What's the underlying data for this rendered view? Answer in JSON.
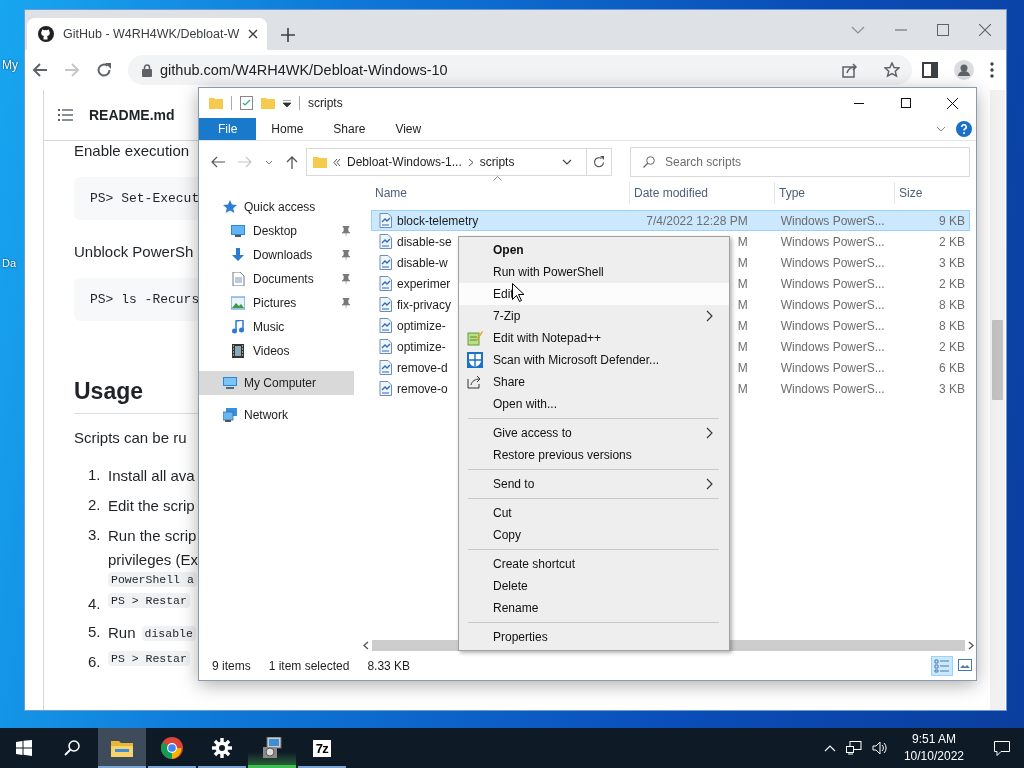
{
  "desktop": {
    "icon_labels": [
      "My",
      "Da"
    ]
  },
  "browser": {
    "tab": {
      "title": "GitHub - W4RH4WK/Debloat-W",
      "selected": true
    },
    "url": "github.com/W4RH4WK/Debloat-Windows-10",
    "readme": {
      "file": "README.md",
      "blocks": [
        {
          "kind": "paragraph",
          "text": "Enable execution"
        },
        {
          "kind": "code",
          "text": "PS> Set-Execut"
        },
        {
          "kind": "paragraph",
          "text": "Unblock PowerSh"
        },
        {
          "kind": "code",
          "text": "PS> ls -Recurs"
        },
        {
          "kind": "heading",
          "text": "Usage"
        },
        {
          "kind": "paragraph",
          "text": "Scripts can be ru"
        },
        {
          "kind": "list",
          "items": [
            {
              "number": "1.",
              "lines": [
                [
                  {
                    "text": "Install all ava",
                    "code": false
                  }
                ]
              ]
            },
            {
              "number": "2.",
              "lines": [
                [
                  {
                    "text": "Edit the scrip",
                    "code": false
                  }
                ]
              ]
            },
            {
              "number": "3.",
              "lines": [
                [
                  {
                    "text": "Run the scrip",
                    "code": false
                  }
                ],
                [
                  {
                    "text": "privileges (Ex",
                    "code": false
                  }
                ],
                [
                  {
                    "text": "PowerShell a",
                    "code": true
                  }
                ]
              ]
            },
            {
              "number": "4.",
              "lines": [
                [
                  {
                    "text": "PS > Restar",
                    "code": true
                  }
                ]
              ]
            },
            {
              "number": "5.",
              "lines": [
                [
                  {
                    "text": "Run",
                    "code": false
                  },
                  {
                    "text": "disable",
                    "code": true
                  }
                ]
              ]
            },
            {
              "number": "6.",
              "lines": [
                [
                  {
                    "text": "PS > Restar",
                    "code": true
                  }
                ]
              ]
            }
          ]
        }
      ]
    }
  },
  "explorer": {
    "title": "scripts",
    "ribbon_tabs": [
      {
        "label": "File",
        "selected": true
      },
      {
        "label": "Home",
        "selected": false
      },
      {
        "label": "Share",
        "selected": false
      },
      {
        "label": "View",
        "selected": false
      }
    ],
    "address": {
      "parent": "Debloat-Windows-1...",
      "current": "scripts"
    },
    "search": {
      "placeholder": "Search scripts"
    },
    "nav": [
      {
        "label": "Quick access",
        "kind": "quick-access",
        "pinned": false,
        "selected": false
      },
      {
        "label": "Desktop",
        "kind": "desktop",
        "pinned": true,
        "selected": false
      },
      {
        "label": "Downloads",
        "kind": "downloads",
        "pinned": true,
        "selected": false
      },
      {
        "label": "Documents",
        "kind": "documents",
        "pinned": true,
        "selected": false
      },
      {
        "label": "Pictures",
        "kind": "pictures",
        "pinned": true,
        "selected": false
      },
      {
        "label": "Music",
        "kind": "music",
        "pinned": false,
        "selected": false
      },
      {
        "label": "Videos",
        "kind": "videos",
        "pinned": false,
        "selected": false
      },
      {
        "label": "My Computer",
        "kind": "computer",
        "pinned": false,
        "selected": true
      },
      {
        "label": "Network",
        "kind": "network",
        "pinned": false,
        "selected": false
      }
    ],
    "columns": [
      "Name",
      "Date modified",
      "Type",
      "Size"
    ],
    "files": [
      {
        "name": "block-telemetry",
        "date": "7/4/2022 12:28 PM",
        "type": "Windows PowerS...",
        "size": "9 KB",
        "selected": true
      },
      {
        "name": "disable-se",
        "date": "M",
        "type": "Windows PowerS...",
        "size": "2 KB",
        "selected": false
      },
      {
        "name": "disable-w",
        "date": "M",
        "type": "Windows PowerS...",
        "size": "3 KB",
        "selected": false
      },
      {
        "name": "experimer",
        "date": "M",
        "type": "Windows PowerS...",
        "size": "2 KB",
        "selected": false
      },
      {
        "name": "fix-privacy",
        "date": "M",
        "type": "Windows PowerS...",
        "size": "8 KB",
        "selected": false
      },
      {
        "name": "optimize-",
        "date": "M",
        "type": "Windows PowerS...",
        "size": "8 KB",
        "selected": false
      },
      {
        "name": "optimize-",
        "date": "M",
        "type": "Windows PowerS...",
        "size": "2 KB",
        "selected": false
      },
      {
        "name": "remove-d",
        "date": "M",
        "type": "Windows PowerS...",
        "size": "6 KB",
        "selected": false
      },
      {
        "name": "remove-o",
        "date": "M",
        "type": "Windows PowerS...",
        "size": "3 KB",
        "selected": false
      }
    ],
    "status": {
      "count": "9 items",
      "selection": "1 item selected",
      "size": "8.33 KB"
    }
  },
  "context_menu": {
    "items": [
      {
        "kind": "command",
        "label": "Open",
        "default": true,
        "highlighted": false,
        "submenu": false
      },
      {
        "kind": "command",
        "label": "Run with PowerShell",
        "default": false,
        "highlighted": false,
        "submenu": false
      },
      {
        "kind": "command",
        "label": "Edit",
        "default": false,
        "highlighted": true,
        "submenu": false
      },
      {
        "kind": "command",
        "label": "7-Zip",
        "default": false,
        "highlighted": false,
        "submenu": true
      },
      {
        "kind": "notepad",
        "label": "Edit with Notepad++",
        "default": false,
        "highlighted": false,
        "submenu": false
      },
      {
        "kind": "defender",
        "label": "Scan with Microsoft Defender...",
        "default": false,
        "highlighted": false,
        "submenu": false
      },
      {
        "kind": "share",
        "label": "Share",
        "default": false,
        "highlighted": false,
        "submenu": false
      },
      {
        "kind": "command",
        "label": "Open with...",
        "default": false,
        "highlighted": false,
        "submenu": false
      },
      {
        "kind": "separator"
      },
      {
        "kind": "command",
        "label": "Give access to",
        "default": false,
        "highlighted": false,
        "submenu": true
      },
      {
        "kind": "command",
        "label": "Restore previous versions",
        "default": false,
        "highlighted": false,
        "submenu": false
      },
      {
        "kind": "separator"
      },
      {
        "kind": "command",
        "label": "Send to",
        "default": false,
        "highlighted": false,
        "submenu": true
      },
      {
        "kind": "separator"
      },
      {
        "kind": "command",
        "label": "Cut",
        "default": false,
        "highlighted": false,
        "submenu": false
      },
      {
        "kind": "command",
        "label": "Copy",
        "default": false,
        "highlighted": false,
        "submenu": false
      },
      {
        "kind": "separator"
      },
      {
        "kind": "command",
        "label": "Create shortcut",
        "default": false,
        "highlighted": false,
        "submenu": false
      },
      {
        "kind": "command",
        "label": "Delete",
        "default": false,
        "highlighted": false,
        "submenu": false
      },
      {
        "kind": "command",
        "label": "Rename",
        "default": false,
        "highlighted": false,
        "submenu": false
      },
      {
        "kind": "separator"
      },
      {
        "kind": "command",
        "label": "Properties",
        "default": false,
        "highlighted": false,
        "submenu": false
      }
    ]
  },
  "taskbar": {
    "apps": [
      {
        "kind": "explorer",
        "active": true,
        "attention": false
      },
      {
        "kind": "chrome",
        "active": false,
        "attention": false
      },
      {
        "kind": "settings",
        "active": false,
        "attention": false
      },
      {
        "kind": "installer",
        "active": false,
        "attention": true
      },
      {
        "kind": "sevenzip",
        "label": "7z",
        "active": false,
        "attention": false
      }
    ],
    "clock": {
      "time": "9:51 AM",
      "date": "10/10/2022"
    }
  }
}
